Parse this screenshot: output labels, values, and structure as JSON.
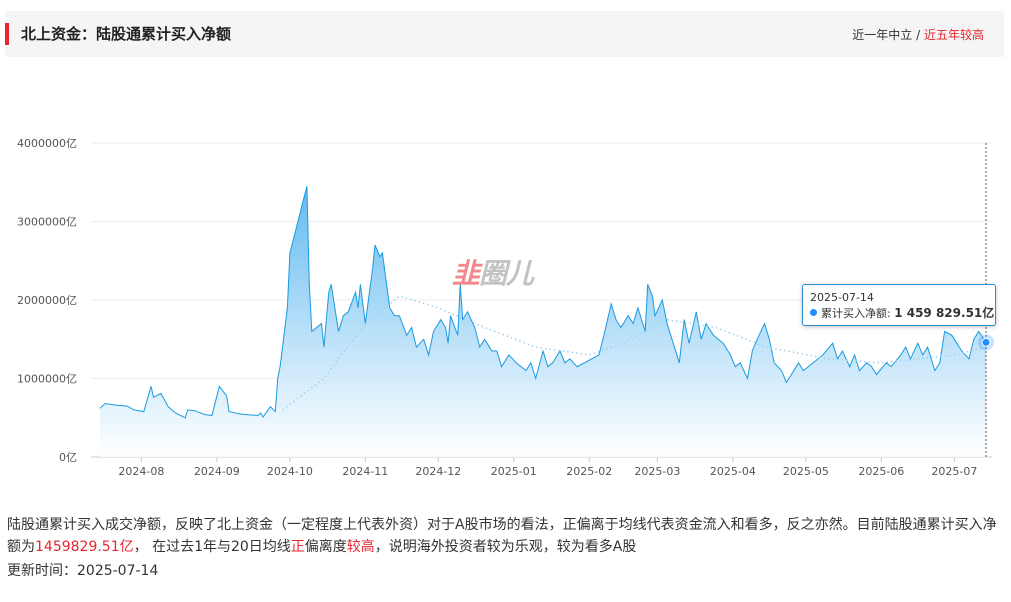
{
  "header": {
    "title": "北上资金：陆股通累计买入净额",
    "status_prefix": "近一年中立",
    "status_sep": " / ",
    "status_highlight": "近五年较高"
  },
  "colors": {
    "accent_red": "#e8262f",
    "line_blue": "#1a9ae0",
    "fill_top": "#5ab6f0",
    "fill_bottom": "#ffffff",
    "avg_line": "#9fd0ee",
    "tooltip_border": "#2a8fd0"
  },
  "watermark": {
    "mark": "韭",
    "text": "圈儿"
  },
  "tooltip": {
    "date": "2025-07-14",
    "series_label": "累计买入净额: ",
    "value": "1 459 829.51亿"
  },
  "description": {
    "part1": "陆股通累计买入成交净额，反映了北上资金（一定程度上代表外资）对于A股市场的看法，正偏离于均线代表资金流入和看多，反之亦然。目前陆股通累计买入净额为",
    "value": "1459829.51亿",
    "part2": "， 在过去1年与20日均线",
    "dev1": "正",
    "part3": "偏离度",
    "dev2": "较高",
    "part4": "，说明海外投资者较为乐观，较为看多A股"
  },
  "updated": {
    "label": "更新时间：",
    "value": "2025-07-14"
  },
  "chart_data": {
    "type": "area",
    "x_range": [
      "2024-07-15",
      "2025-07-14"
    ],
    "ylim": [
      0,
      4000000
    ],
    "y_ticks": [
      0,
      1000000,
      2000000,
      3000000,
      4000000
    ],
    "y_tick_labels": [
      "0亿",
      "1000000亿",
      "2000000亿",
      "3000000亿",
      "4000000亿"
    ],
    "x_tick_labels": [
      "2024-08",
      "2024-09",
      "2024-10",
      "2024-11",
      "2024-12",
      "2025-01",
      "2025-02",
      "2025-03",
      "2025-04",
      "2025-05",
      "2025-06",
      "2025-07"
    ],
    "x_tick_dates": [
      "2024-08-01",
      "2024-09-01",
      "2024-10-01",
      "2024-11-01",
      "2024-12-01",
      "2025-01-01",
      "2025-02-01",
      "2025-03-01",
      "2025-04-01",
      "2025-05-01",
      "2025-06-01",
      "2025-07-01"
    ],
    "grid": "horizontal",
    "series": [
      {
        "name": "累计买入净额",
        "points": [
          [
            "2024-07-15",
            620000
          ],
          [
            "2024-07-17",
            680000
          ],
          [
            "2024-07-22",
            660000
          ],
          [
            "2024-07-26",
            650000
          ],
          [
            "2024-07-29",
            600000
          ],
          [
            "2024-08-02",
            580000
          ],
          [
            "2024-08-05",
            900000
          ],
          [
            "2024-08-06",
            760000
          ],
          [
            "2024-08-09",
            810000
          ],
          [
            "2024-08-12",
            640000
          ],
          [
            "2024-08-15",
            560000
          ],
          [
            "2024-08-19",
            500000
          ],
          [
            "2024-08-20",
            600000
          ],
          [
            "2024-08-23",
            590000
          ],
          [
            "2024-08-27",
            540000
          ],
          [
            "2024-08-30",
            530000
          ],
          [
            "2024-09-02",
            900000
          ],
          [
            "2024-09-05",
            780000
          ],
          [
            "2024-09-06",
            580000
          ],
          [
            "2024-09-10",
            550000
          ],
          [
            "2024-09-13",
            540000
          ],
          [
            "2024-09-18",
            530000
          ],
          [
            "2024-09-19",
            560000
          ],
          [
            "2024-09-20",
            510000
          ],
          [
            "2024-09-23",
            640000
          ],
          [
            "2024-09-25",
            580000
          ],
          [
            "2024-09-26",
            1000000
          ],
          [
            "2024-09-27",
            1150000
          ],
          [
            "2024-09-30",
            1900000
          ],
          [
            "2024-10-01",
            2600000
          ],
          [
            "2024-10-08",
            3450000
          ],
          [
            "2024-10-09",
            2200000
          ],
          [
            "2024-10-10",
            1600000
          ],
          [
            "2024-10-14",
            1700000
          ],
          [
            "2024-10-15",
            1400000
          ],
          [
            "2024-10-17",
            2100000
          ],
          [
            "2024-10-18",
            2200000
          ],
          [
            "2024-10-21",
            1600000
          ],
          [
            "2024-10-23",
            1800000
          ],
          [
            "2024-10-25",
            1850000
          ],
          [
            "2024-10-28",
            2100000
          ],
          [
            "2024-10-29",
            1900000
          ],
          [
            "2024-10-30",
            2200000
          ],
          [
            "2024-11-01",
            1700000
          ],
          [
            "2024-11-04",
            2400000
          ],
          [
            "2024-11-05",
            2700000
          ],
          [
            "2024-11-07",
            2550000
          ],
          [
            "2024-11-08",
            2600000
          ],
          [
            "2024-11-11",
            1900000
          ],
          [
            "2024-11-13",
            1800000
          ],
          [
            "2024-11-15",
            1800000
          ],
          [
            "2024-11-18",
            1550000
          ],
          [
            "2024-11-20",
            1650000
          ],
          [
            "2024-11-22",
            1400000
          ],
          [
            "2024-11-25",
            1500000
          ],
          [
            "2024-11-27",
            1300000
          ],
          [
            "2024-11-29",
            1600000
          ],
          [
            "2024-12-02",
            1750000
          ],
          [
            "2024-12-04",
            1650000
          ],
          [
            "2024-12-05",
            1450000
          ],
          [
            "2024-12-06",
            1800000
          ],
          [
            "2024-12-09",
            1550000
          ],
          [
            "2024-12-10",
            2200000
          ],
          [
            "2024-12-11",
            1750000
          ],
          [
            "2024-12-13",
            1850000
          ],
          [
            "2024-12-16",
            1650000
          ],
          [
            "2024-12-18",
            1400000
          ],
          [
            "2024-12-20",
            1500000
          ],
          [
            "2024-12-23",
            1350000
          ],
          [
            "2024-12-25",
            1350000
          ],
          [
            "2024-12-27",
            1150000
          ],
          [
            "2024-12-30",
            1300000
          ],
          [
            "2025-01-02",
            1200000
          ],
          [
            "2025-01-06",
            1100000
          ],
          [
            "2025-01-08",
            1200000
          ],
          [
            "2025-01-10",
            1000000
          ],
          [
            "2025-01-13",
            1350000
          ],
          [
            "2025-01-15",
            1150000
          ],
          [
            "2025-01-17",
            1200000
          ],
          [
            "2025-01-20",
            1350000
          ],
          [
            "2025-01-22",
            1200000
          ],
          [
            "2025-01-24",
            1250000
          ],
          [
            "2025-01-27",
            1150000
          ],
          [
            "2025-02-05",
            1300000
          ],
          [
            "2025-02-07",
            1550000
          ],
          [
            "2025-02-10",
            1950000
          ],
          [
            "2025-02-12",
            1750000
          ],
          [
            "2025-02-14",
            1650000
          ],
          [
            "2025-02-17",
            1800000
          ],
          [
            "2025-02-19",
            1700000
          ],
          [
            "2025-02-21",
            1900000
          ],
          [
            "2025-02-24",
            1600000
          ],
          [
            "2025-02-25",
            2200000
          ],
          [
            "2025-02-27",
            2050000
          ],
          [
            "2025-02-28",
            1800000
          ],
          [
            "2025-03-03",
            2000000
          ],
          [
            "2025-03-05",
            1700000
          ],
          [
            "2025-03-07",
            1500000
          ],
          [
            "2025-03-10",
            1200000
          ],
          [
            "2025-03-12",
            1750000
          ],
          [
            "2025-03-14",
            1450000
          ],
          [
            "2025-03-17",
            1850000
          ],
          [
            "2025-03-19",
            1500000
          ],
          [
            "2025-03-21",
            1700000
          ],
          [
            "2025-03-24",
            1550000
          ],
          [
            "2025-03-26",
            1500000
          ],
          [
            "2025-03-28",
            1450000
          ],
          [
            "2025-03-31",
            1300000
          ],
          [
            "2025-04-02",
            1150000
          ],
          [
            "2025-04-04",
            1200000
          ],
          [
            "2025-04-07",
            1000000
          ],
          [
            "2025-04-09",
            1350000
          ],
          [
            "2025-04-11",
            1500000
          ],
          [
            "2025-04-14",
            1700000
          ],
          [
            "2025-04-16",
            1500000
          ],
          [
            "2025-04-18",
            1200000
          ],
          [
            "2025-04-21",
            1100000
          ],
          [
            "2025-04-23",
            950000
          ],
          [
            "2025-04-25",
            1050000
          ],
          [
            "2025-04-28",
            1200000
          ],
          [
            "2025-04-30",
            1100000
          ],
          [
            "2025-05-06",
            1250000
          ],
          [
            "2025-05-08",
            1300000
          ],
          [
            "2025-05-12",
            1450000
          ],
          [
            "2025-05-14",
            1250000
          ],
          [
            "2025-05-16",
            1350000
          ],
          [
            "2025-05-19",
            1150000
          ],
          [
            "2025-05-21",
            1300000
          ],
          [
            "2025-05-23",
            1100000
          ],
          [
            "2025-05-26",
            1200000
          ],
          [
            "2025-05-28",
            1150000
          ],
          [
            "2025-05-30",
            1050000
          ],
          [
            "2025-06-03",
            1200000
          ],
          [
            "2025-06-05",
            1150000
          ],
          [
            "2025-06-09",
            1300000
          ],
          [
            "2025-06-11",
            1400000
          ],
          [
            "2025-06-13",
            1250000
          ],
          [
            "2025-06-16",
            1450000
          ],
          [
            "2025-06-18",
            1300000
          ],
          [
            "2025-06-20",
            1400000
          ],
          [
            "2025-06-23",
            1100000
          ],
          [
            "2025-06-25",
            1200000
          ],
          [
            "2025-06-27",
            1600000
          ],
          [
            "2025-06-30",
            1550000
          ],
          [
            "2025-07-02",
            1450000
          ],
          [
            "2025-07-04",
            1350000
          ],
          [
            "2025-07-07",
            1250000
          ],
          [
            "2025-07-09",
            1500000
          ],
          [
            "2025-07-11",
            1600000
          ],
          [
            "2025-07-14",
            1459829.51
          ]
        ]
      },
      {
        "points": [
          [
            "2024-09-28",
            600000
          ],
          [
            "2024-10-15",
            1000000
          ],
          [
            "2024-11-01",
            1700000
          ],
          [
            "2024-11-15",
            2050000
          ],
          [
            "2024-12-01",
            1900000
          ],
          [
            "2024-12-20",
            1650000
          ],
          [
            "2025-01-10",
            1400000
          ],
          [
            "2025-02-01",
            1300000
          ],
          [
            "2025-02-15",
            1450000
          ],
          [
            "2025-03-05",
            1750000
          ],
          [
            "2025-03-25",
            1650000
          ],
          [
            "2025-04-15",
            1400000
          ],
          [
            "2025-05-10",
            1250000
          ],
          [
            "2025-06-01",
            1200000
          ],
          [
            "2025-07-01",
            1300000
          ],
          [
            "2025-07-14",
            1400000
          ]
        ]
      }
    ]
  }
}
